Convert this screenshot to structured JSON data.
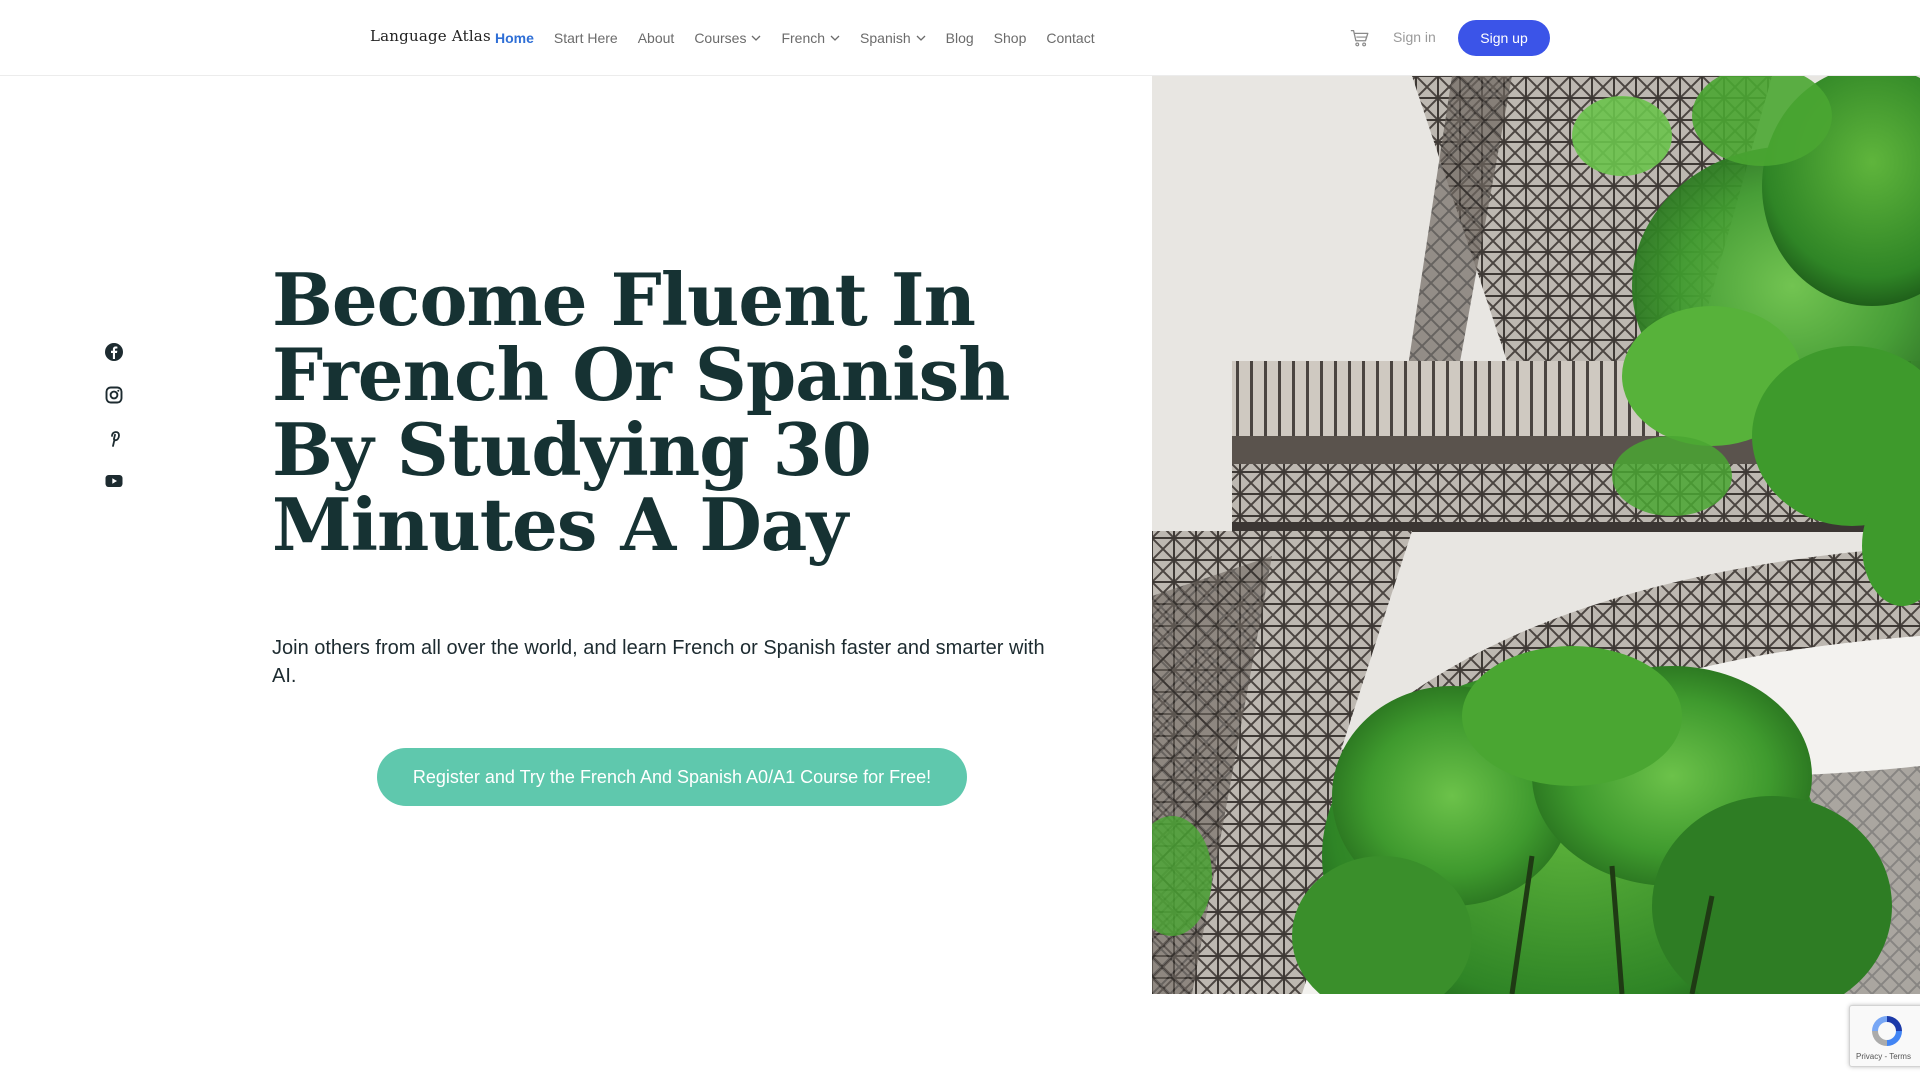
{
  "header": {
    "logo": "Language Atlas",
    "nav": [
      {
        "label": "Home",
        "active": true,
        "dropdown": false
      },
      {
        "label": "Start Here",
        "active": false,
        "dropdown": false
      },
      {
        "label": "About",
        "active": false,
        "dropdown": false
      },
      {
        "label": "Courses",
        "active": false,
        "dropdown": true
      },
      {
        "label": "French",
        "active": false,
        "dropdown": true
      },
      {
        "label": "Spanish",
        "active": false,
        "dropdown": true
      },
      {
        "label": "Blog",
        "active": false,
        "dropdown": false
      },
      {
        "label": "Shop",
        "active": false,
        "dropdown": false
      },
      {
        "label": "Contact",
        "active": false,
        "dropdown": false
      }
    ],
    "cart_icon": "cart-icon",
    "signin_label": "Sign in",
    "signup_label": "Sign up"
  },
  "social": [
    "facebook-icon",
    "instagram-icon",
    "pinterest-icon",
    "youtube-icon"
  ],
  "hero": {
    "title": "Become Fluent In French Or Spanish By Studying 30 Minutes A Day",
    "subtitle": "Join others from all over the world, and learn French or Spanish faster and smarter with AI.",
    "cta_label": "Register and Try the French And Spanish A0/A1 Course for Free!"
  },
  "recaptcha": {
    "links": "Privacy - Terms"
  },
  "colors": {
    "accent": "#2f6fd6",
    "signup_bg": "#3b54e8",
    "cta_bg": "#5fc8ad",
    "title_color": "#163233"
  }
}
